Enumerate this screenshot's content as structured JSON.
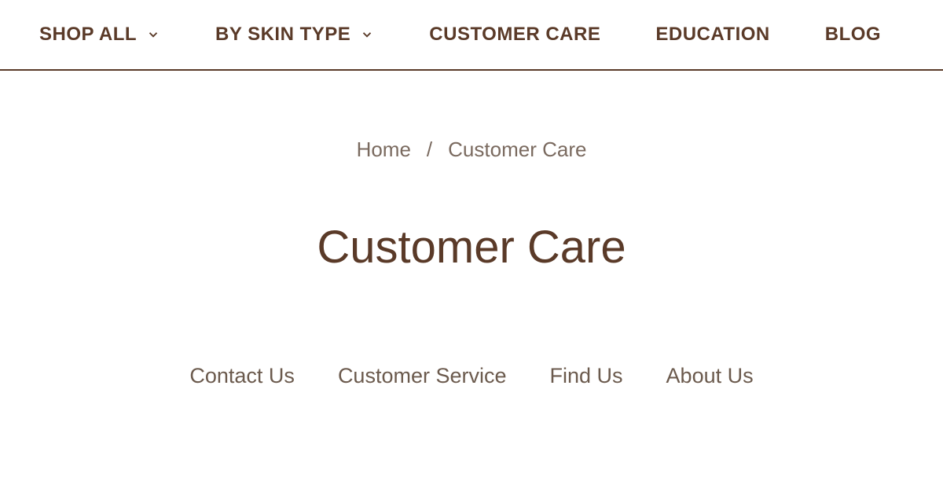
{
  "nav": {
    "items": [
      {
        "label": "SHOP ALL",
        "has_dropdown": true
      },
      {
        "label": "BY SKIN TYPE",
        "has_dropdown": true
      },
      {
        "label": "CUSTOMER CARE",
        "has_dropdown": false
      },
      {
        "label": "EDUCATION",
        "has_dropdown": false
      },
      {
        "label": "BLOG",
        "has_dropdown": false
      }
    ]
  },
  "breadcrumb": {
    "home": "Home",
    "separator": "/",
    "current": "Customer Care"
  },
  "page": {
    "title": "Customer Care"
  },
  "tabs": [
    "Contact Us",
    "Customer Service",
    "Find Us",
    "About Us"
  ],
  "colors": {
    "primary": "#5a3a28",
    "muted": "#7a6a5f"
  }
}
